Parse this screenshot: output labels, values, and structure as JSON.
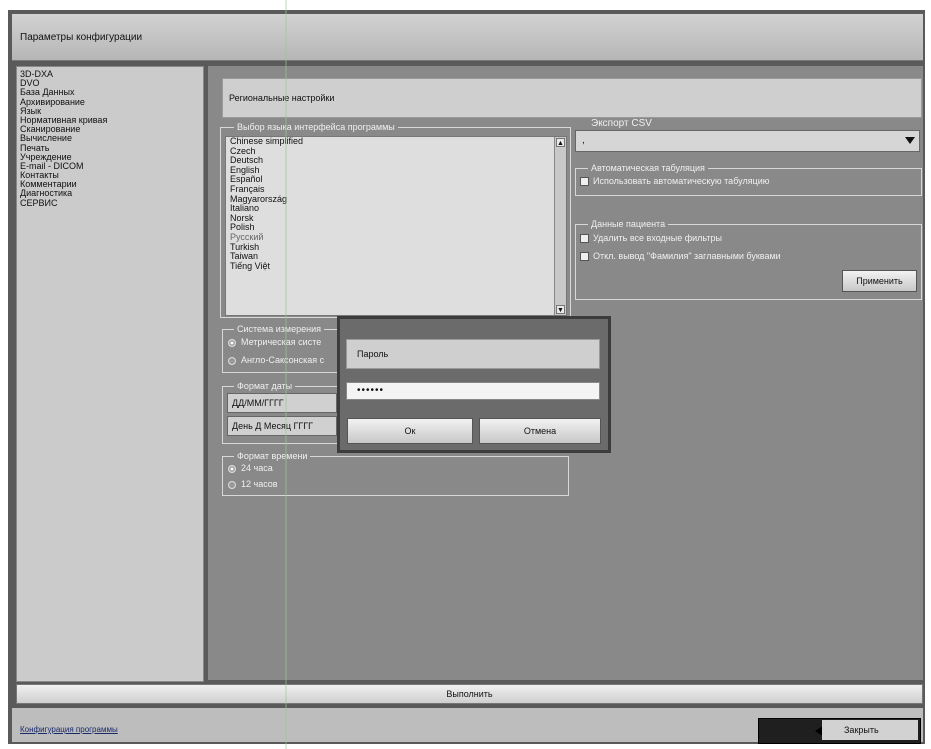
{
  "window": {
    "title": "Параметры конфигурации"
  },
  "sidebar": {
    "items": [
      {
        "label": "3D-DXA"
      },
      {
        "label": "DVO"
      },
      {
        "label": "База Данных"
      },
      {
        "label": "Архивирование"
      },
      {
        "label": "Язык"
      },
      {
        "label": "Нормативная кривая"
      },
      {
        "label": "Сканирование"
      },
      {
        "label": "Вычисление"
      },
      {
        "label": "Печать"
      },
      {
        "label": "Учреждение"
      },
      {
        "label": "E-mail - DICOM"
      },
      {
        "label": "Контакты"
      },
      {
        "label": "Комментарии"
      },
      {
        "label": "Диагностика"
      },
      {
        "label": "СЕРВИС"
      }
    ]
  },
  "section": {
    "title": "Региональные настройки"
  },
  "language": {
    "group_title": "Выбор языка интерфейса программы",
    "items": [
      "Chinese simplified",
      "Czech",
      "Deutsch",
      "English",
      "Español",
      "Français",
      "Magyarország",
      "Italiano",
      "Norsk",
      "Polish",
      "Русский",
      "Turkish",
      "Taiwan",
      "Tiếng Việt"
    ],
    "selected": "Русский"
  },
  "measurement": {
    "group_title": "Система измерения",
    "options": [
      "Метрическая систе",
      "Англо-Саксонская с"
    ],
    "selected": 0
  },
  "date_format": {
    "group_title": "Формат даты",
    "value1": "ДД/ММ/ГГГГ",
    "value2": "День Д Месяц ГГГГ"
  },
  "time_format": {
    "group_title": "Формат времени",
    "options": [
      "24 часа",
      "12 часов"
    ],
    "selected": 0
  },
  "csv_export": {
    "group_title": "Экспорт CSV",
    "value": ","
  },
  "auto_tab": {
    "group_title": "Автоматическая табуляция",
    "checkbox_label": "Использовать автоматическую табуляцию",
    "checked": true
  },
  "patient_data": {
    "group_title": "Данные пациента",
    "check1": "Удалить все входные фильтры",
    "check2": "Откл. вывод \"Фамилия\" заглавными буквами",
    "apply_label": "Применить"
  },
  "password_dialog": {
    "label": "Пароль",
    "value": "••••••",
    "ok_label": "Ок",
    "cancel_label": "Отмена"
  },
  "execute_label": "Выполнить",
  "footer": {
    "link": "Конфигурация программы",
    "close_label": "Закрыть"
  }
}
